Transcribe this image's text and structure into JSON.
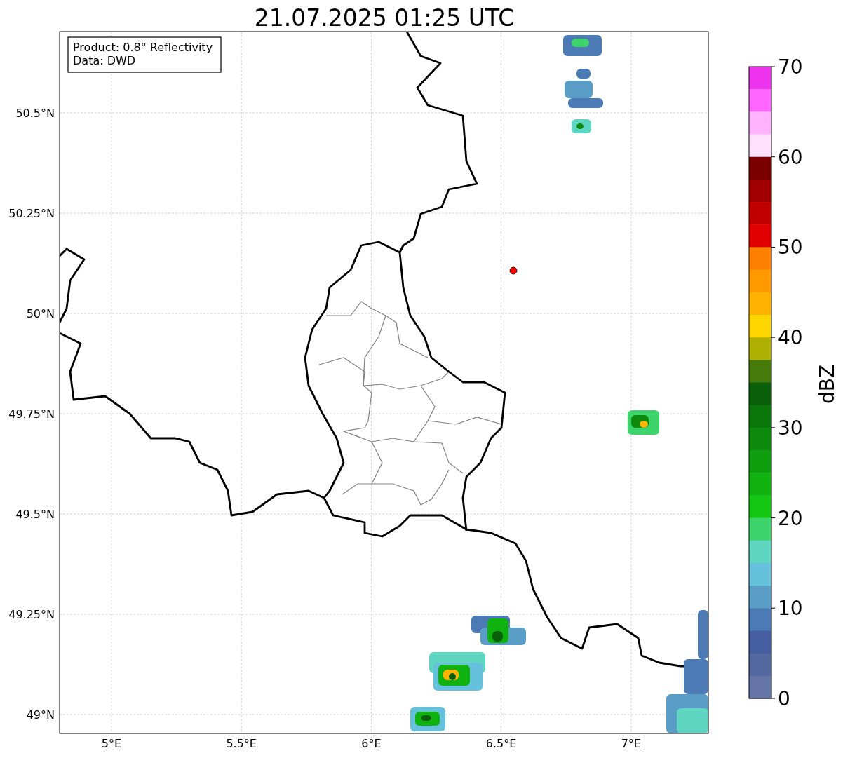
{
  "title": "21.07.2025 01:25 UTC",
  "info_box": [
    "Product: 0.8° Reflectivity",
    "Data: DWD"
  ],
  "yticks": [
    "50.5°N",
    "50.25°N",
    "50°N",
    "49.75°N",
    "49.5°N",
    "49.25°N",
    "49°N"
  ],
  "xticks": [
    "5°E",
    "5.5°E",
    "6°E",
    "6.5°E",
    "7°E"
  ],
  "colorbar": {
    "label": "dBZ",
    "ticks": [
      "70",
      "60",
      "50",
      "40",
      "30",
      "20",
      "10",
      "0"
    ],
    "segments": [
      {
        "color": "#ee33ee"
      },
      {
        "color": "#ff66ff"
      },
      {
        "color": "#ffb3ff"
      },
      {
        "color": "#ffe0ff"
      },
      {
        "color": "#7a0000"
      },
      {
        "color": "#a00000"
      },
      {
        "color": "#c00000"
      },
      {
        "color": "#e00000"
      },
      {
        "color": "#ff7f00"
      },
      {
        "color": "#ff9900"
      },
      {
        "color": "#ffb300"
      },
      {
        "color": "#ffd700"
      },
      {
        "color": "#b0b000"
      },
      {
        "color": "#467a0b"
      },
      {
        "color": "#0a5f0a"
      },
      {
        "color": "#0b770b"
      },
      {
        "color": "#0d8a0d"
      },
      {
        "color": "#0e9e0e"
      },
      {
        "color": "#10b210"
      },
      {
        "color": "#12c612"
      },
      {
        "color": "#3dd56b"
      },
      {
        "color": "#5ed6c2"
      },
      {
        "color": "#66c2dc"
      },
      {
        "color": "#5a9ec8"
      },
      {
        "color": "#4b7ab4"
      },
      {
        "color": "#445ea0"
      },
      {
        "color": "#52689f"
      },
      {
        "color": "#6575a8"
      }
    ]
  }
}
